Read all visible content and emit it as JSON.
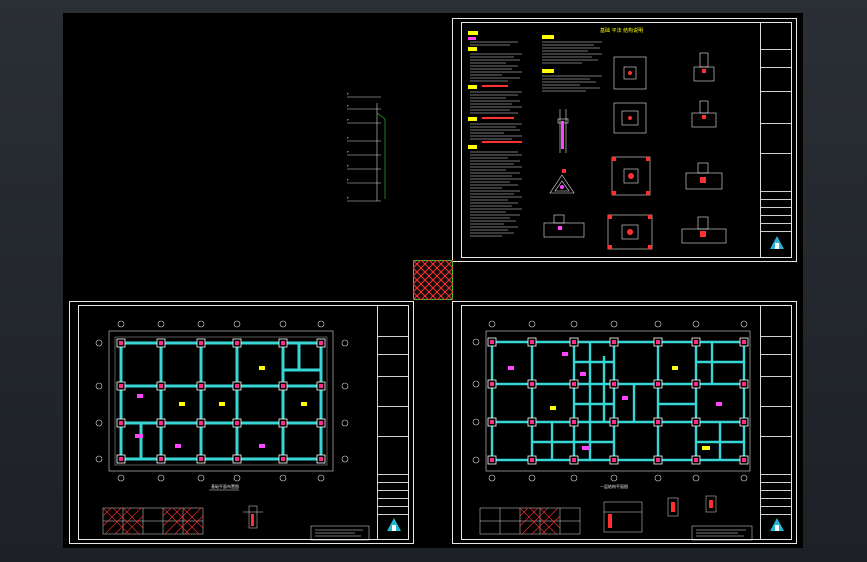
{
  "viewport": {
    "background": "#000000",
    "frame_color": "#232830"
  },
  "colors": {
    "beam": "#36d6d6",
    "column": "#ffffff",
    "marker": "#ff2a8a",
    "hatch": "#ff3030",
    "note_head": "#ffff00",
    "note_alt": "#ff44ff",
    "text": "#e6e6e6",
    "border": "#e8e8e8",
    "grid_line": "#ff3030",
    "swatch_border": "#37c837",
    "logo": "#23b5d3"
  },
  "sheets": {
    "details": {
      "title": "基础 平法 结构说明"
    },
    "left_plan": {
      "plan_caption": "基础平面布置图"
    },
    "right_plan": {
      "plan_caption": "一层结构平面图"
    }
  },
  "icons": {
    "swatch": "hatch-swatch-icon",
    "logo": "logo-icon",
    "grid_bubble": "grid-bubble-icon"
  }
}
